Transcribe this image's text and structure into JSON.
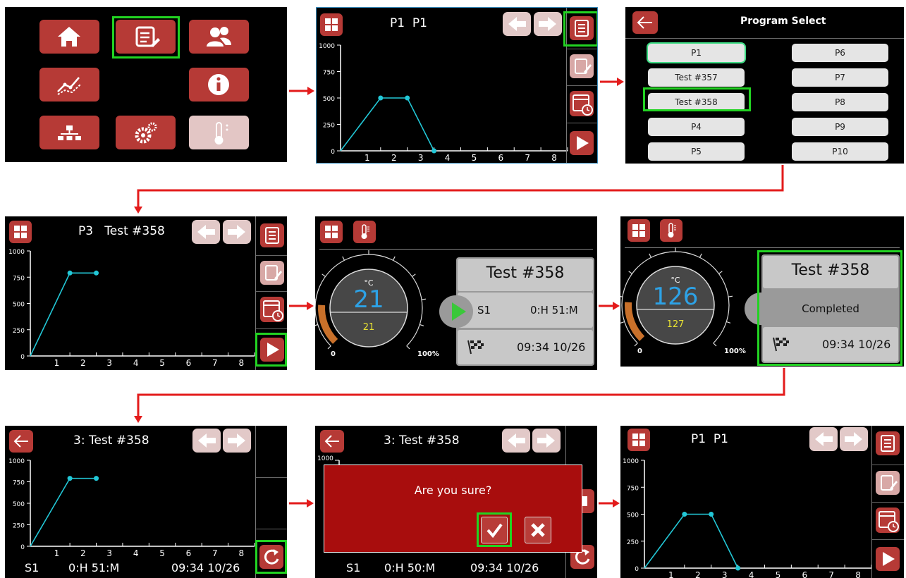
{
  "colors": {
    "accent_red": "#b63a36",
    "plot_line": "#22c7d6",
    "highlight": "#22d322",
    "arrow": "#e31b1b"
  },
  "home_menu": {
    "icons": [
      "home-icon",
      "program-edit-icon",
      "users-icon",
      "chart-icon",
      "info-icon",
      "network-icon",
      "settings-icon",
      "thermometer-icon"
    ]
  },
  "graph_axes": {
    "y_ticks": [
      "1000",
      "750",
      "500",
      "250",
      "0"
    ],
    "x_ticks": [
      "1",
      "2",
      "3",
      "4",
      "5",
      "6",
      "7",
      "8"
    ]
  },
  "screen2": {
    "title": "P1  P1",
    "chart_data": {
      "type": "line",
      "x": [
        0,
        1.5,
        2.5,
        3.5
      ],
      "y": [
        0,
        500,
        500,
        0
      ],
      "ylim": [
        0,
        1000
      ],
      "xlim": [
        0,
        8.5
      ]
    }
  },
  "program_select": {
    "title": "Program Select",
    "left": [
      "P1",
      "Test #357",
      "Test #358",
      "P4",
      "P5"
    ],
    "right": [
      "P6",
      "P7",
      "P8",
      "P9",
      "P10"
    ]
  },
  "screen4": {
    "title": "P3   Test #358",
    "chart_data": {
      "type": "line",
      "x": [
        0,
        1.5,
        2.5
      ],
      "y": [
        0,
        790,
        790
      ],
      "ylim": [
        0,
        1000
      ],
      "xlim": [
        0,
        8.5
      ]
    }
  },
  "screen5": {
    "unit": "°C",
    "temp": "21",
    "setpoint": "21",
    "gauge_min": "0",
    "gauge_max": "100%",
    "gauge_fill_fraction": 0.18,
    "program": "Test #358",
    "segment": "S1",
    "time": "0:H 51:M",
    "end": "09:34 10/26"
  },
  "screen6": {
    "unit": "°C",
    "temp": "126",
    "setpoint": "127",
    "gauge_min": "0",
    "gauge_max": "100%",
    "gauge_fill_fraction": 0.18,
    "program": "Test #358",
    "status": "Completed",
    "end": "09:34 10/26"
  },
  "screen7": {
    "title": "3: Test #358",
    "segment": "S1",
    "time": "0:H 51:M",
    "end": "09:34 10/26",
    "chart_data": {
      "type": "line",
      "x": [
        0,
        1.5,
        2.5
      ],
      "y": [
        0,
        790,
        790
      ],
      "ylim": [
        0,
        1000
      ],
      "xlim": [
        0,
        8.5
      ]
    }
  },
  "screen8": {
    "title": "3: Test #358",
    "segment": "S1",
    "time": "0:H 50:M",
    "end": "09:34 10/26",
    "confirm_text": "Are you sure?"
  },
  "screen9": {
    "title": "P1  P1",
    "chart_data": {
      "type": "line",
      "x": [
        0,
        1.5,
        2.5,
        3.5
      ],
      "y": [
        0,
        500,
        500,
        0
      ],
      "ylim": [
        0,
        1000
      ],
      "xlim": [
        0,
        8.5
      ]
    }
  }
}
